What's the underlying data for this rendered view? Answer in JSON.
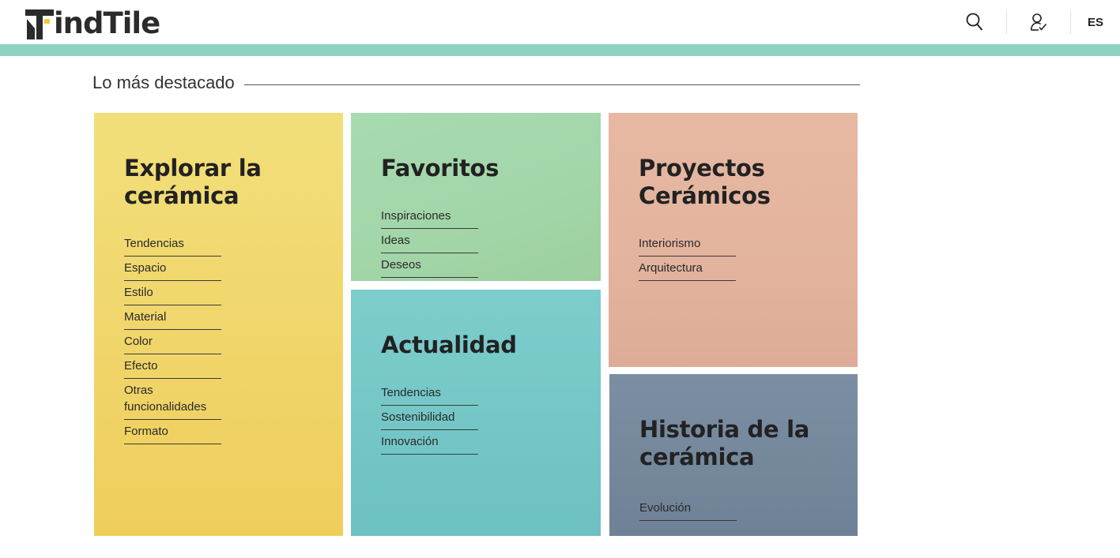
{
  "header": {
    "logo_text": "indTile",
    "language": "ES",
    "icons": [
      "search-icon",
      "user-check-icon"
    ]
  },
  "colors": {
    "accent_bar": "#8dd1c1",
    "yellow": "#f0d56a",
    "green": "#a2d5a8",
    "teal": "#74c6c6",
    "peach": "#e3b39d",
    "slate": "#74879b"
  },
  "section": {
    "title": "Lo más destacado"
  },
  "cards": {
    "explorar": {
      "title_line1": "Explorar la",
      "title_line2": "cerámica",
      "links": [
        "Tendencias",
        "Espacio",
        "Estilo",
        "Material",
        "Color",
        "Efecto",
        "Otras funcionalidades",
        "Formato"
      ]
    },
    "favoritos": {
      "title_line1": "Favoritos",
      "links": [
        "Inspiraciones",
        "Ideas",
        "Deseos"
      ]
    },
    "actualidad": {
      "title_line1": "Actualidad",
      "links": [
        "Tendencias",
        "Sostenibilidad",
        "Innovación"
      ]
    },
    "proyectos": {
      "title_line1": "Proyectos",
      "title_line2": "Cerámicos",
      "links": [
        "Interiorismo",
        "Arquitectura"
      ]
    },
    "historia": {
      "title_line1": "Historia de la",
      "title_line2": "cerámica",
      "links": [
        "Evolución"
      ]
    }
  }
}
